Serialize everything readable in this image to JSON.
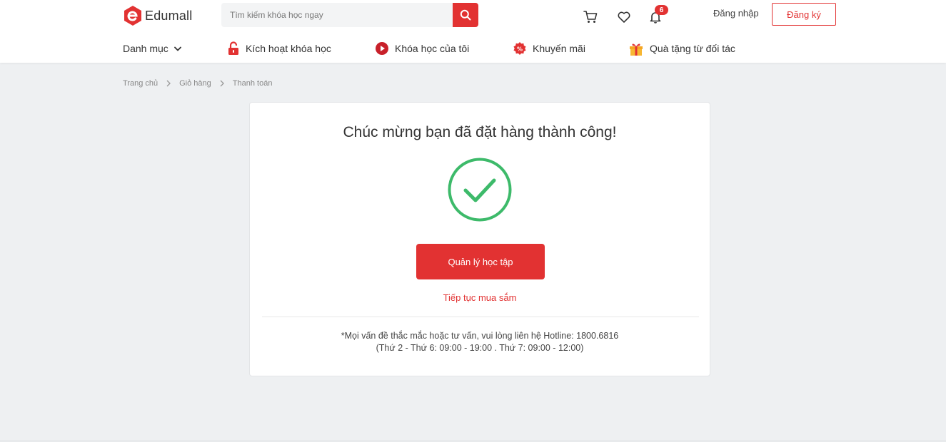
{
  "brand": {
    "name": "Edumall",
    "accent_color": "#e23232"
  },
  "header": {
    "search": {
      "placeholder": "Tìm kiếm khóa học ngay",
      "icon": "search-icon"
    },
    "cart_icon": "cart-icon",
    "wishlist_icon": "heart-icon",
    "notifications": {
      "icon": "bell-icon",
      "count": "6"
    },
    "login_label": "Đăng nhập",
    "register_label": "Đăng ký"
  },
  "nav": {
    "category_label": "Danh mục",
    "items": [
      {
        "label": "Kích hoạt khóa học",
        "icon": "unlock-icon"
      },
      {
        "label": "Khóa học của tôi",
        "icon": "play-circle-icon"
      },
      {
        "label": "Khuyến mãi",
        "icon": "discount-badge-icon"
      },
      {
        "label": "Quà tặng từ đối tác",
        "icon": "gift-icon"
      }
    ]
  },
  "breadcrumb": [
    "Trang chủ",
    "Giỏ hàng",
    "Thanh toán"
  ],
  "success": {
    "title": "Chúc mừng bạn đã đặt hàng thành công!",
    "icon": "check-circle-icon",
    "icon_color": "#3dba6a",
    "primary_button": "Quản lý học tập",
    "continue_link": "Tiếp tục mua sắm",
    "hotline_line1": "*Mọi vấn đề thắc mắc hoặc tư vấn, vui lòng liên hệ Hotline: 1800.6816",
    "hotline_line2": "(Thứ 2 - Thứ 6: 09:00 - 19:00 . Thứ 7: 09:00 - 12:00)"
  }
}
